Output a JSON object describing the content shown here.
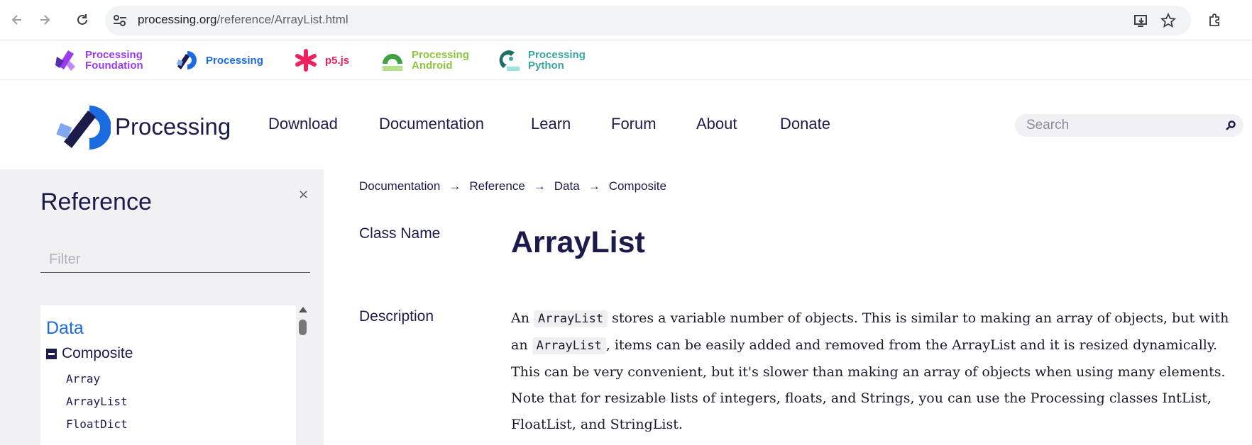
{
  "browser": {
    "url_host": "processing.org",
    "url_path": "/reference/ArrayList.html",
    "icons": [
      "back-icon",
      "forward-icon",
      "reload-icon",
      "site-info-icon",
      "install-icon",
      "star-icon",
      "extensions-icon"
    ]
  },
  "foundation_bar": {
    "items": [
      {
        "label": "Processing\nFoundation",
        "color": "#9a3df0"
      },
      {
        "label": "Processing",
        "color": "#1a6ce0"
      },
      {
        "label": "p5.js",
        "color": "#ed225d"
      },
      {
        "label": "Processing\nAndroid",
        "color": "#8cc63f"
      },
      {
        "label": "Processing\nPython",
        "color": "#3aa6a0"
      }
    ]
  },
  "header": {
    "logo_text": "Processing",
    "nav": [
      "Download",
      "Documentation",
      "Learn",
      "Forum",
      "About",
      "Donate"
    ],
    "search_placeholder": "Search"
  },
  "sidebar": {
    "title": "Reference",
    "close": "×",
    "filter_placeholder": "Filter",
    "category": "Data",
    "subcategory": "Composite",
    "items": [
      "Array",
      "ArrayList",
      "FloatDict"
    ]
  },
  "content": {
    "breadcrumb": [
      "Documentation",
      "Reference",
      "Data",
      "Composite"
    ],
    "breadcrumb_sep": "→",
    "class_label": "Class Name",
    "class_name": "ArrayList",
    "desc_label": "Description",
    "desc": {
      "t1": "An ",
      "c1": "ArrayList",
      "t2": " stores a variable number of objects. This is similar to making an array of objects, but with an ",
      "c2": "ArrayList",
      "t3": ", items can be easily added and removed from the ArrayList and it is resized dynamically. This can be very convenient, but it's slower than making an array of objects when using many elements. Note that for resizable lists of integers, floats, and Strings, you can use the Processing classes IntList, FloatList, and StringList."
    }
  },
  "colors": {
    "navy": "#1c1c4c",
    "processing_blue": "#1a6ce0",
    "sidebar_bg": "#f1f1f4"
  }
}
